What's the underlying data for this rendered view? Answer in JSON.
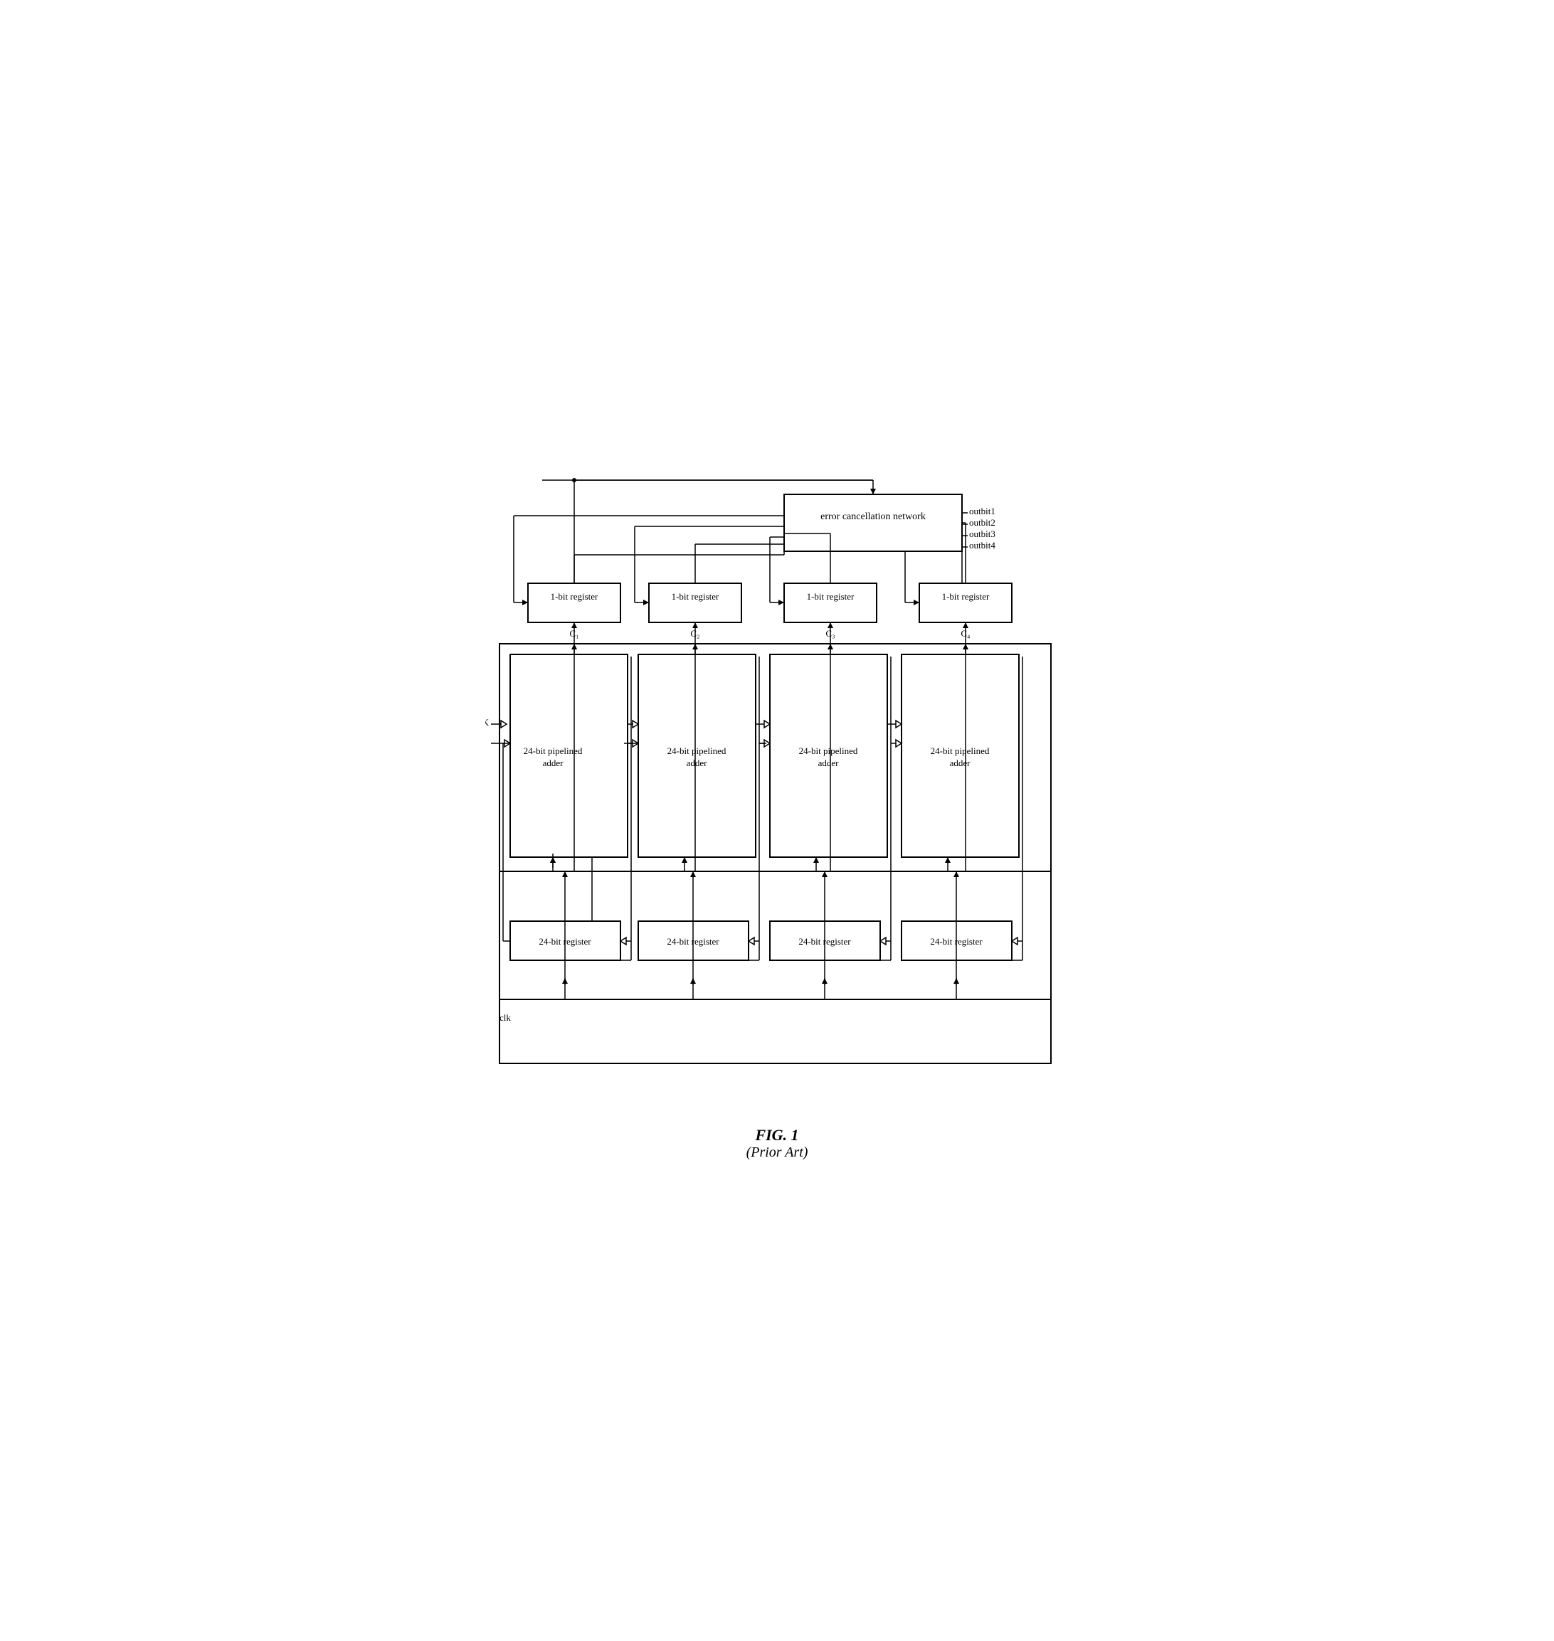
{
  "diagram": {
    "title": "FIG. 1",
    "subtitle": "(Prior Art)",
    "ecn_label": "error cancellation network",
    "outbits": [
      "outbit1",
      "outbit2",
      "outbit3",
      "outbit4"
    ],
    "registers_1bit": [
      "1-bit register",
      "1-bit register",
      "1-bit register",
      "1-bit register"
    ],
    "clocks": [
      "C₁",
      "C₂",
      "C₃",
      "C₄"
    ],
    "adders": [
      "24-bit pipelined\nadder",
      "24-bit pipelined\nadder",
      "24-bit pipelined\nadder",
      "24-bit pipelined\nadder"
    ],
    "registers_24bit": [
      "24-bit register",
      "24-bit register",
      "24-bit register",
      "24-bit register"
    ],
    "k_label": "K",
    "clk_label": "clk"
  },
  "caption": {
    "title": "FIG. 1",
    "subtitle": "(Prior Art)"
  }
}
